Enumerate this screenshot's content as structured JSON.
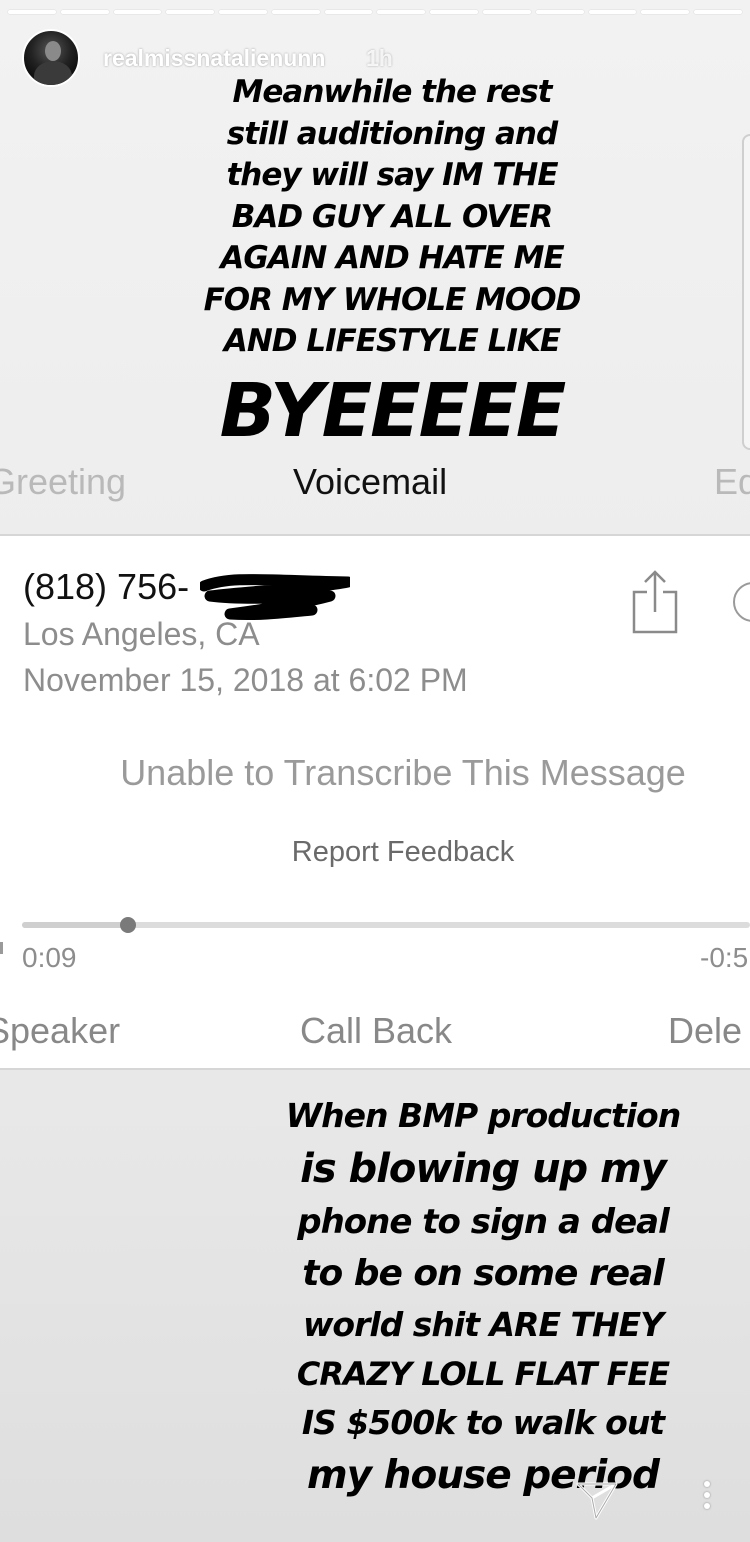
{
  "story": {
    "segment_count": 14,
    "username": "realmissnatalienunn",
    "time_ago": "1h"
  },
  "caption_top": {
    "lines": [
      "Meanwhile the rest",
      "still auditioning and",
      "they will say IM THE",
      "BAD GUY ALL OVER",
      "AGAIN AND HATE ME",
      "FOR MY WHOLE MOOD",
      "AND LIFESTYLE LIKE"
    ],
    "big": "BYEEEEE"
  },
  "voicemail": {
    "tabs": {
      "left": "Greeting",
      "center": "Voicemail",
      "right": "Ed"
    },
    "phone": "(818) 756-",
    "location": "Los Angeles, CA",
    "datetime": "November 15, 2018 at 6:02 PM",
    "transcription": "Unable to Transcribe This Message",
    "feedback": "Report Feedback",
    "playback": {
      "elapsed": "0:09",
      "remaining": "-0:5",
      "progress": 0.145
    },
    "actions": {
      "speaker": "Speaker",
      "call_back": "Call Back",
      "delete": "Dele"
    }
  },
  "caption_bottom": {
    "lines": [
      "When BMP production",
      "is blowing up my",
      "phone to sign a deal",
      "to be on some real",
      "world shit ARE THEY",
      "CRAZY LOLL FLAT FEE",
      "IS $500k to walk out",
      "my house period"
    ]
  },
  "icons": {
    "share": "share-icon",
    "info": "info-icon",
    "direct": "direct-message-icon",
    "more": "more-options-icon"
  }
}
